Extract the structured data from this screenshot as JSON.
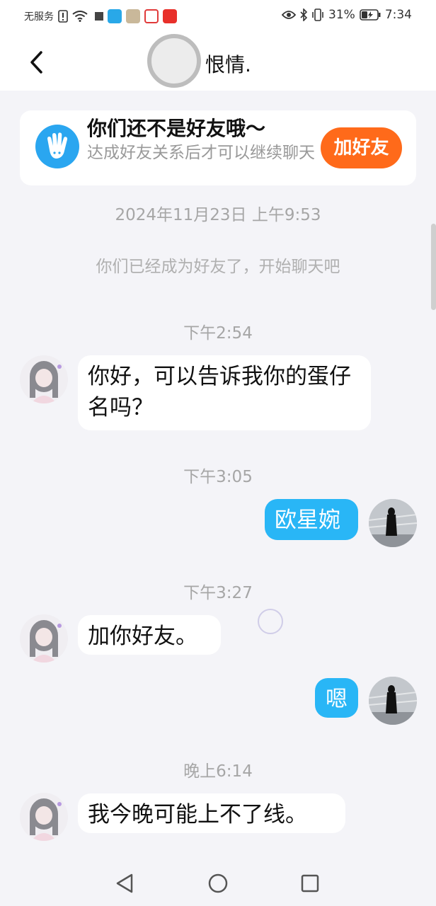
{
  "status_bar": {
    "service": "无服务",
    "battery": "31%",
    "time": "7:34"
  },
  "header": {
    "contact_name": "恨情."
  },
  "friend_banner": {
    "title": "你们还不是好友哦～",
    "description": "达成好友关系后才可以继续聊天",
    "add_button": "加好友"
  },
  "chat": {
    "first_timestamp": "2024年11月23日 上午9:53",
    "system_message": "你们已经成为好友了，开始聊天吧",
    "groups": [
      {
        "time": "下午2:54",
        "sender": "them",
        "text": "你好，可以告诉我你的蛋仔名吗？"
      },
      {
        "time": "下午3:05",
        "sender": "me",
        "text": "欧星婉"
      },
      {
        "time": "下午3:27",
        "sender": "them",
        "text": "加你好友。"
      },
      {
        "sender": "me",
        "text": "嗯"
      },
      {
        "time": "晚上6:14",
        "sender": "them",
        "text": "我今晚可能上不了线。"
      }
    ]
  },
  "colors": {
    "accent_blue": "#29b6f6",
    "add_friend_orange": "#ff6a1a",
    "background": "#f4f4f8"
  }
}
